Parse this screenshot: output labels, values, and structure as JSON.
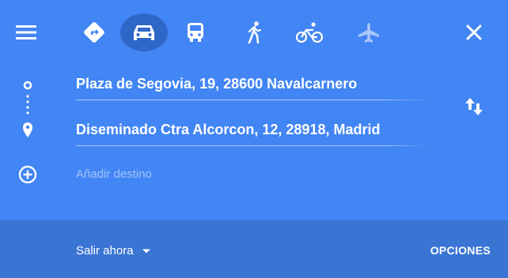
{
  "icons": {
    "menu": "menu-icon",
    "best_route": "directions-icon",
    "driving": "car-icon",
    "transit": "train-icon",
    "walking": "walk-icon",
    "cycling": "bike-icon",
    "flights": "plane-icon",
    "close": "close-icon",
    "origin_marker": "origin-circle-icon",
    "destination_marker": "destination-pin-icon",
    "add": "add-circle-icon",
    "swap": "swap-icon",
    "dropdown": "caret-down-icon"
  },
  "colors": {
    "panel": "#4285f4",
    "selected_mode": "#2f67c8",
    "bottom_bar": "#3a75d4",
    "text": "#ffffff"
  },
  "route": {
    "origin": "Plaza de Segovia, 19, 28600 Navalcarnero",
    "destination": "Diseminado Ctra Alcorcon, 12, 28918, Madrid",
    "add_destination": "Añadir destino",
    "selected_mode": "driving"
  },
  "bottom": {
    "depart_label": "Salir ahora",
    "options_label": "OPCIONES"
  }
}
